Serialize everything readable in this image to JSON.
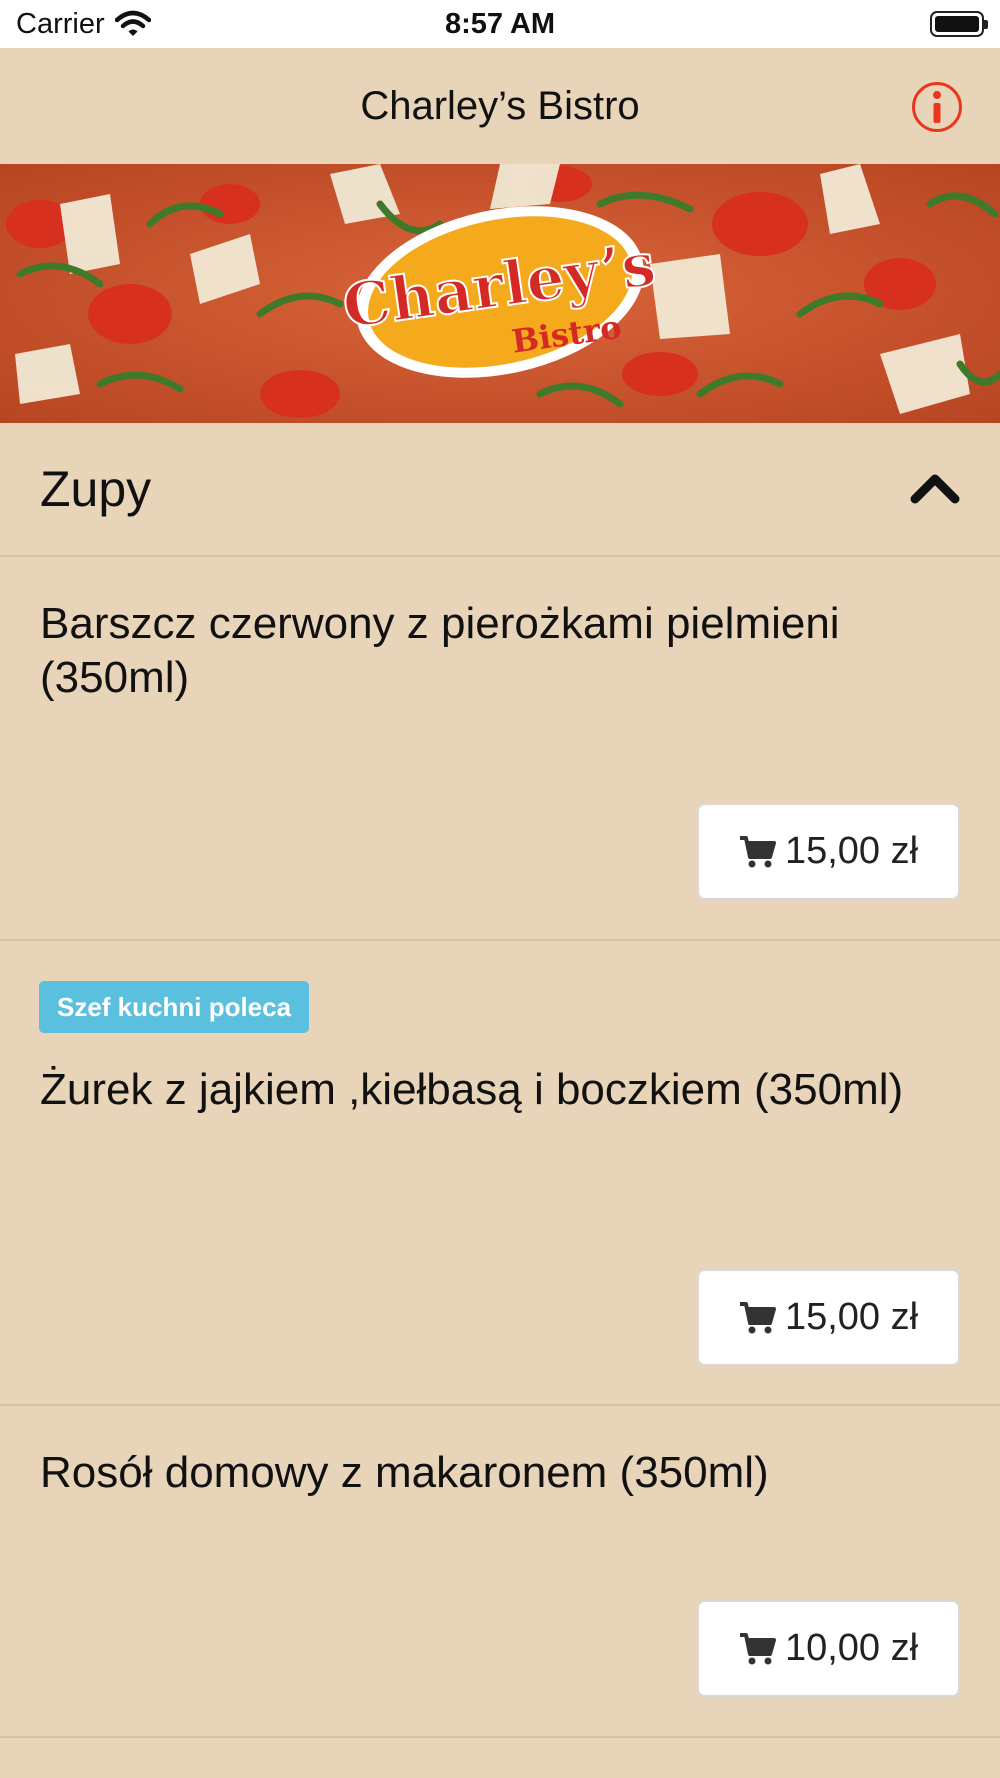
{
  "status_bar": {
    "carrier": "Carrier",
    "time": "8:57 AM"
  },
  "nav": {
    "title": "Charley’s Bistro",
    "info_icon": "info-circle-icon",
    "accent_color": "#E8371E"
  },
  "banner": {
    "logo_main": "Charley’s",
    "logo_sub": "Bistro"
  },
  "category": {
    "title": "Zupy",
    "chevron_icon": "chevron-up-icon"
  },
  "items": [
    {
      "name": "Barszcz czerwony z pierożkami pielmieni (350ml)",
      "badge": "",
      "price": "15,00 zł"
    },
    {
      "name": "Żurek z jajkiem ,kiełbasą i boczkiem (350ml)",
      "badge": "Szef kuchni poleca",
      "price": "15,00 zł"
    },
    {
      "name": "Rosół domowy z makaronem (350ml)",
      "badge": "",
      "price": "10,00 zł"
    }
  ],
  "colors": {
    "background": "#E8D5B9",
    "badge": "#5BC0DE"
  }
}
